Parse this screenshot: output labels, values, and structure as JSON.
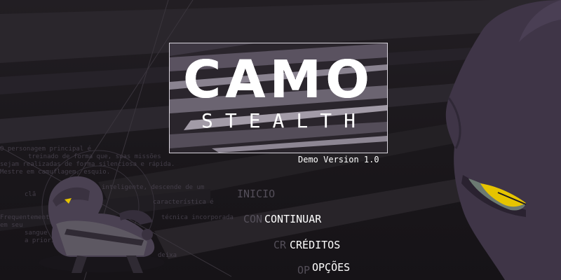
{
  "logo": {
    "title": "CAMO",
    "subtitle": "STEALTH"
  },
  "version": "Demo Version 1.0",
  "menu": {
    "ghost": [
      "INICIO",
      "CON",
      "CR",
      "OP"
    ],
    "items": [
      "CONTINUAR",
      "CRÉDITOS",
      "OPÇÕES"
    ]
  },
  "background_text": [
    "O personagem principal é",
    "treinado de forma que, suas missões",
    "sejam realizadas de forma silenciosa e rápida.",
    "Mestre em camuflagem, esquio.",
    "inteligente, descende de um",
    "clã",
    "característica é",
    "Frequentemente",
    "técnica incorporada",
    "em seu",
    "sangue",
    "a priori",
    "deixa"
  ],
  "colors": {
    "accent_eye": "#e6c400",
    "monster": "#3f3547",
    "logo_border": "#d8d4dc"
  }
}
